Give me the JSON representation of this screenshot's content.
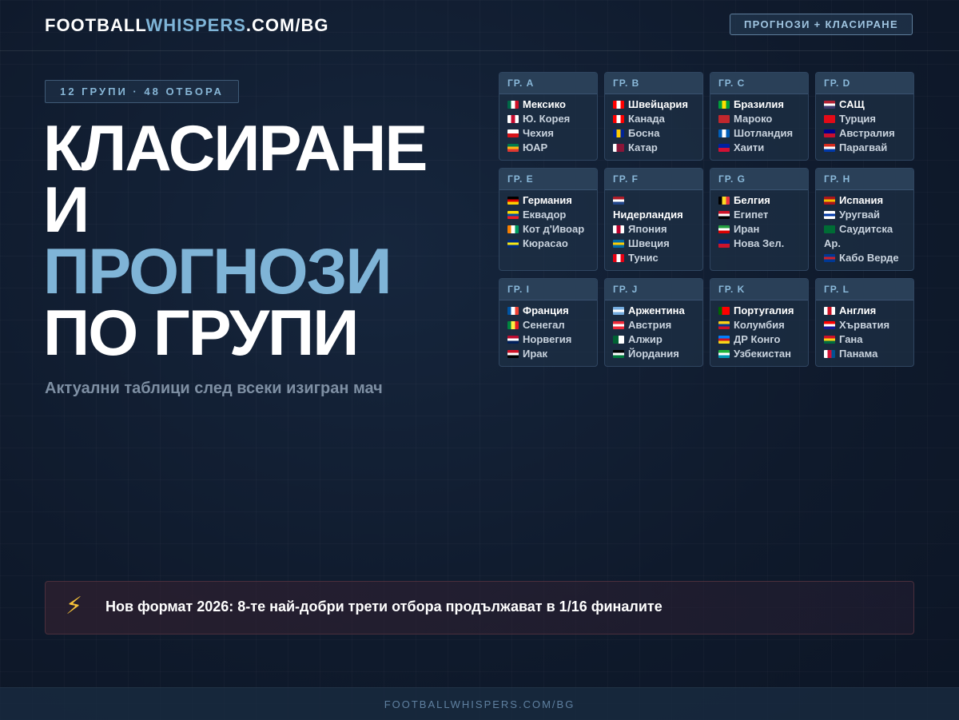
{
  "header": {
    "brand_part1": "FOOTBALL",
    "brand_part2": "WHISPERS",
    "brand_part3": ".COM/BG",
    "nav_button": "ПРОГНОЗИ + КЛАСИРАНЕ"
  },
  "hero": {
    "badge": "12 ГРУПИ · 48 ОТБОРА",
    "title_line1": "КЛАСИРАНЕ",
    "title_line2": "И",
    "title_line3": "ПРОГНОЗИ",
    "title_line4": "ПО ГРУПИ",
    "subtitle": "Актуални таблици след всеки изигран мач"
  },
  "colors": {
    "accent": "#7fb4d7",
    "background": "#0f1a2c",
    "bolt": "#f6c23a"
  },
  "groups": [
    {
      "name": "ГР. A",
      "teams": [
        {
          "name": "Мексико",
          "flag": [
            "#006847",
            "#ffffff",
            "#ce1126"
          ],
          "dir": "v"
        },
        {
          "name": "Ю. Корея",
          "flag": [
            "#ffffff",
            "#c60c30",
            "#ffffff"
          ],
          "dir": "v"
        },
        {
          "name": "Чехия",
          "flag": [
            "#ffffff",
            "#d7141a"
          ],
          "dir": "h"
        },
        {
          "name": "ЮАР",
          "flag": [
            "#007a4d",
            "#ffb612",
            "#de3831"
          ],
          "dir": "h"
        }
      ]
    },
    {
      "name": "ГР. B",
      "teams": [
        {
          "name": "Швейцария",
          "flag": [
            "#ff0000",
            "#ffffff",
            "#ff0000"
          ],
          "dir": "v"
        },
        {
          "name": "Канада",
          "flag": [
            "#ff0000",
            "#ffffff",
            "#ff0000"
          ],
          "dir": "v"
        },
        {
          "name": "Босна",
          "flag": [
            "#002395",
            "#fecb00",
            "#002395"
          ],
          "dir": "v"
        },
        {
          "name": "Катар",
          "flag": [
            "#ffffff",
            "#8a1538",
            "#8a1538"
          ],
          "dir": "v"
        }
      ]
    },
    {
      "name": "ГР. C",
      "teams": [
        {
          "name": "Бразилия",
          "flag": [
            "#009c3b",
            "#ffdf00",
            "#009c3b"
          ],
          "dir": "v"
        },
        {
          "name": "Мароко",
          "flag": [
            "#c1272d",
            "#c1272d"
          ],
          "dir": "h"
        },
        {
          "name": "Шотландия",
          "flag": [
            "#005eb8",
            "#ffffff",
            "#005eb8"
          ],
          "dir": "v"
        },
        {
          "name": "Хаити",
          "flag": [
            "#00209f",
            "#d21034"
          ],
          "dir": "h"
        }
      ]
    },
    {
      "name": "ГР. D",
      "teams": [
        {
          "name": "САЩ",
          "flag": [
            "#b22234",
            "#ffffff",
            "#3c3b6e"
          ],
          "dir": "h"
        },
        {
          "name": "Турция",
          "flag": [
            "#e30a17",
            "#e30a17"
          ],
          "dir": "h"
        },
        {
          "name": "Австралия",
          "flag": [
            "#00008b",
            "#c8102e"
          ],
          "dir": "h"
        },
        {
          "name": "Парагвай",
          "flag": [
            "#d52b1e",
            "#ffffff",
            "#0038a8"
          ],
          "dir": "h"
        }
      ]
    },
    {
      "name": "ГР. E",
      "teams": [
        {
          "name": "Германия",
          "flag": [
            "#000000",
            "#dd0000",
            "#ffce00"
          ],
          "dir": "h"
        },
        {
          "name": "Еквадор",
          "flag": [
            "#ffdd00",
            "#034ea2",
            "#ed1c24"
          ],
          "dir": "h"
        },
        {
          "name": "Кот д'Ивоар",
          "flag": [
            "#f77f00",
            "#ffffff",
            "#009e60"
          ],
          "dir": "v"
        },
        {
          "name": "Кюрасао",
          "flag": [
            "#002b7f",
            "#f9e814",
            "#002b7f"
          ],
          "dir": "h"
        }
      ]
    },
    {
      "name": "ГР. F",
      "teams": [
        {
          "name": "Нидерландия",
          "flag": [
            "#ae1c28",
            "#ffffff",
            "#21468b"
          ],
          "dir": "h"
        },
        {
          "name": "Япония",
          "flag": [
            "#ffffff",
            "#bc002d",
            "#ffffff"
          ],
          "dir": "v"
        },
        {
          "name": "Швеция",
          "flag": [
            "#006aa7",
            "#fecc00",
            "#006aa7"
          ],
          "dir": "h"
        },
        {
          "name": "Тунис",
          "flag": [
            "#e70013",
            "#ffffff",
            "#e70013"
          ],
          "dir": "v"
        }
      ]
    },
    {
      "name": "ГР. G",
      "teams": [
        {
          "name": "Белгия",
          "flag": [
            "#000000",
            "#fdda24",
            "#ef3340"
          ],
          "dir": "v"
        },
        {
          "name": "Египет",
          "flag": [
            "#ce1126",
            "#ffffff",
            "#000000"
          ],
          "dir": "h"
        },
        {
          "name": "Иран",
          "flag": [
            "#239f40",
            "#ffffff",
            "#da0000"
          ],
          "dir": "h"
        },
        {
          "name": "Нова Зел.",
          "flag": [
            "#00247d",
            "#cc142b"
          ],
          "dir": "h"
        }
      ]
    },
    {
      "name": "ГР. H",
      "teams": [
        {
          "name": "Испания",
          "flag": [
            "#aa151b",
            "#f1bf00",
            "#aa151b"
          ],
          "dir": "h"
        },
        {
          "name": "Уругвай",
          "flag": [
            "#ffffff",
            "#0038a8",
            "#ffffff"
          ],
          "dir": "h"
        },
        {
          "name": "Саудитска Ар.",
          "flag": [
            "#006c35",
            "#006c35"
          ],
          "dir": "h"
        },
        {
          "name": "Кабо Верде",
          "flag": [
            "#003893",
            "#cf2027",
            "#003893"
          ],
          "dir": "h"
        }
      ]
    },
    {
      "name": "ГР. I",
      "teams": [
        {
          "name": "Франция",
          "flag": [
            "#0055a4",
            "#ffffff",
            "#ef4135"
          ],
          "dir": "v"
        },
        {
          "name": "Сенегал",
          "flag": [
            "#00853f",
            "#fdef42",
            "#e31b23"
          ],
          "dir": "v"
        },
        {
          "name": "Норвегия",
          "flag": [
            "#ba0c2f",
            "#ffffff",
            "#00205b"
          ],
          "dir": "h"
        },
        {
          "name": "Ирак",
          "flag": [
            "#ce1126",
            "#ffffff",
            "#000000"
          ],
          "dir": "h"
        }
      ]
    },
    {
      "name": "ГР. J",
      "teams": [
        {
          "name": "Аржентина",
          "flag": [
            "#74acdf",
            "#ffffff",
            "#74acdf"
          ],
          "dir": "h"
        },
        {
          "name": "Австрия",
          "flag": [
            "#ed2939",
            "#ffffff",
            "#ed2939"
          ],
          "dir": "h"
        },
        {
          "name": "Алжир",
          "flag": [
            "#006233",
            "#ffffff"
          ],
          "dir": "v"
        },
        {
          "name": "Йордания",
          "flag": [
            "#000000",
            "#ffffff",
            "#007a3d"
          ],
          "dir": "h"
        }
      ]
    },
    {
      "name": "ГР. K",
      "teams": [
        {
          "name": "Португалия",
          "flag": [
            "#006600",
            "#ff0000",
            "#ff0000"
          ],
          "dir": "v"
        },
        {
          "name": "Колумбия",
          "flag": [
            "#fcd116",
            "#003893",
            "#ce1126"
          ],
          "dir": "h"
        },
        {
          "name": "ДР Конго",
          "flag": [
            "#007fff",
            "#ce1021",
            "#f7d618"
          ],
          "dir": "h"
        },
        {
          "name": "Узбекистан",
          "flag": [
            "#1eb53a",
            "#ffffff",
            "#0099b5"
          ],
          "dir": "h"
        }
      ]
    },
    {
      "name": "ГР. L",
      "teams": [
        {
          "name": "Англия",
          "flag": [
            "#ffffff",
            "#ce1124",
            "#ffffff"
          ],
          "dir": "v"
        },
        {
          "name": "Хърватия",
          "flag": [
            "#ff0000",
            "#ffffff",
            "#171796"
          ],
          "dir": "h"
        },
        {
          "name": "Гана",
          "flag": [
            "#ce1126",
            "#fcd116",
            "#006b3f"
          ],
          "dir": "h"
        },
        {
          "name": "Панама",
          "flag": [
            "#ffffff",
            "#d21034",
            "#005293"
          ],
          "dir": "v"
        }
      ]
    }
  ],
  "banner": {
    "icon": "lightning-bolt-icon",
    "icon_glyph": "⚡",
    "text": "Нов формат 2026: 8-те най-добри трети отбора продължават в 1/16 финалите"
  },
  "footer": {
    "text": "FOOTBALLWHISPERS.COM/BG"
  }
}
